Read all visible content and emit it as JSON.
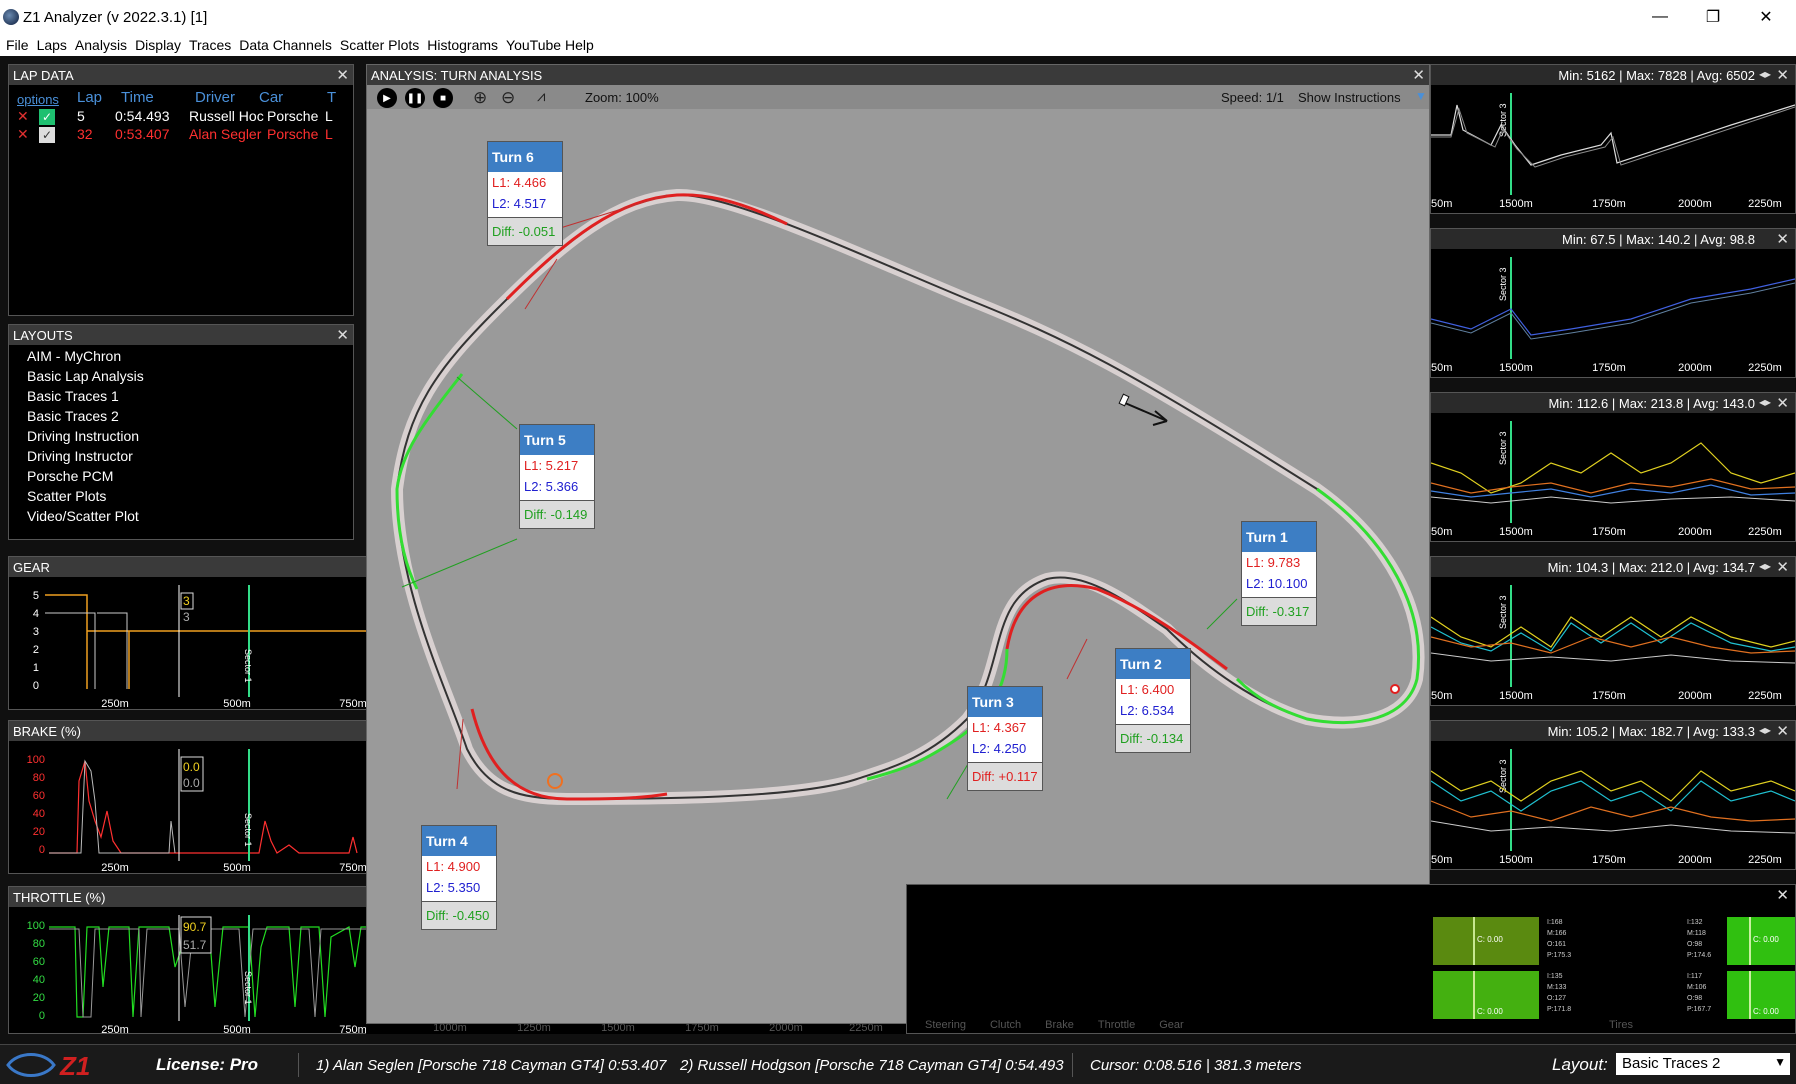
{
  "window": {
    "title": "Z1 Analyzer (v 2022.3.1) [1]",
    "minimize": "—",
    "maximize": "❐",
    "close": "✕"
  },
  "menu": [
    "File",
    "Laps",
    "Analysis",
    "Display",
    "Traces",
    "Data Channels",
    "Scatter Plots",
    "Histograms",
    "YouTube Help"
  ],
  "lap_data": {
    "title": "LAP DATA",
    "columns": [
      "options",
      "Lap",
      "Time",
      "Driver",
      "Car",
      "T"
    ],
    "rows": [
      {
        "lap": "5",
        "time": "0:54.493",
        "driver": "Russell Hoc",
        "car": "Porsche",
        "extra": "L",
        "color": "#ffffff",
        "checked": true
      },
      {
        "lap": "32",
        "time": "0:53.407",
        "driver": "Alan Segler",
        "car": "Porsche",
        "extra": "L",
        "color": "#ff3030",
        "checked": true
      }
    ]
  },
  "layouts": {
    "title": "LAYOUTS",
    "items": [
      "AIM - MyChron",
      "Basic Lap Analysis",
      "Basic Traces 1",
      "Basic Traces 2",
      "Driving Instruction",
      "Driving Instructor",
      "Porsche PCM",
      "Scatter Plots",
      "Video/Scatter Plot"
    ]
  },
  "gear": {
    "title": "GEAR",
    "yticks": [
      "5",
      "4",
      "3",
      "2",
      "1",
      "0"
    ],
    "xticks": [
      "250m",
      "500m",
      "750m"
    ],
    "cursor_l1": "3",
    "cursor_l2": "3",
    "sector": "Sector 1"
  },
  "brake": {
    "title": "BRAKE (%)",
    "yticks": [
      "100",
      "80",
      "60",
      "40",
      "20",
      "0"
    ],
    "xticks": [
      "250m",
      "500m",
      "750m"
    ],
    "cursor_l1": "0.0",
    "cursor_l2": "0.0",
    "sector": "Sector 1"
  },
  "throttle": {
    "title": "THROTTLE (%)",
    "yticks": [
      "100",
      "80",
      "60",
      "40",
      "20",
      "0"
    ],
    "xticks": [
      "250m",
      "500m",
      "750m",
      "1000m",
      "1250m",
      "1500m",
      "1750m",
      "2000m",
      "2250m"
    ],
    "cursor_l1": "90.7",
    "cursor_l2": "51.7",
    "sector": "Sector 1"
  },
  "analysis": {
    "title": "ANALYSIS: TURN ANALYSIS",
    "zoom": "Zoom: 100%",
    "speed": "Speed: 1/1",
    "show_instructions": "Show Instructions",
    "turns": [
      {
        "name": "Turn 6",
        "l1": "L1: 4.466",
        "l2": "L2: 4.517",
        "diff": "Diff: -0.051",
        "diff_color": "#20a020"
      },
      {
        "name": "Turn 5",
        "l1": "L1: 5.217",
        "l2": "L2: 5.366",
        "diff": "Diff: -0.149",
        "diff_color": "#20a020"
      },
      {
        "name": "Turn 1",
        "l1": "L1: 9.783",
        "l2": "L2: 10.100",
        "diff": "Diff: -0.317",
        "diff_color": "#20a020"
      },
      {
        "name": "Turn 2",
        "l1": "L1: 6.400",
        "l2": "L2: 6.534",
        "diff": "Diff: -0.134",
        "diff_color": "#20a020"
      },
      {
        "name": "Turn 3",
        "l1": "L1: 4.367",
        "l2": "L2: 4.250",
        "diff": "Diff: +0.117",
        "diff_color": "#e02020"
      },
      {
        "name": "Turn 4",
        "l1": "L1: 4.900",
        "l2": "L2: 5.350",
        "diff": "Diff: -0.450",
        "diff_color": "#20a020"
      }
    ]
  },
  "right_panels": [
    {
      "stats": "Min: 5162 | Max: 7828 | Avg: 6502",
      "xticks": [
        "50m",
        "1500m",
        "1750m",
        "2000m",
        "2250m"
      ],
      "sector": "Sector 3"
    },
    {
      "stats": "Min: 67.5 | Max: 140.2 | Avg: 98.8",
      "xticks": [
        "50m",
        "1500m",
        "1750m",
        "2000m",
        "2250m"
      ],
      "sector": "Sector 3"
    },
    {
      "stats": "Min: 112.6 | Max: 213.8 | Avg: 143.0",
      "xticks": [
        "50m",
        "1500m",
        "1750m",
        "2000m",
        "2250m"
      ],
      "sector": "Sector 3"
    },
    {
      "stats": "Min: 104.3 | Max: 212.0 | Avg: 134.7",
      "xticks": [
        "50m",
        "1500m",
        "1750m",
        "2000m",
        "2250m"
      ],
      "sector": "Sector 3"
    },
    {
      "stats": "Min: 105.2 | Max: 182.7 | Avg: 133.3",
      "xticks": [
        "50m",
        "1500m",
        "1750m",
        "2000m",
        "2250m"
      ],
      "sector": "Sector 3"
    }
  ],
  "tires": {
    "fl": [
      "I:168",
      "M:166",
      "O:161",
      "P:175.3"
    ],
    "fr": [
      "I:132",
      "M:118",
      "O:98",
      "P:174.6"
    ],
    "rl": [
      "I:135",
      "M:133",
      "O:127",
      "P:171.8"
    ],
    "rr": [
      "I:117",
      "M:106",
      "O:98",
      "P:167.7"
    ],
    "center_label": "C: 0.00",
    "bottom_labels": [
      "Steering",
      "Clutch",
      "Brake",
      "Throttle",
      "Gear",
      "Tires"
    ]
  },
  "status": {
    "logo": "Z1",
    "license": "License: Pro",
    "lap1": "1) Alan Seglen   [Porsche 718 Cayman GT4]   0:53.407",
    "lap2": "2) Russell Hodgson   [Porsche 718 Cayman GT4]   0:54.493",
    "cursor": "Cursor: 0:08.516 | 381.3 meters",
    "layout_label": "Layout:",
    "layout_value": "Basic Traces 2"
  },
  "colors": {
    "lap1": "#ffffff",
    "lap2": "#ff3030",
    "sector": "#33dd88",
    "turn_header": "#3d7ec4",
    "accent_blue": "#4a90d9"
  }
}
